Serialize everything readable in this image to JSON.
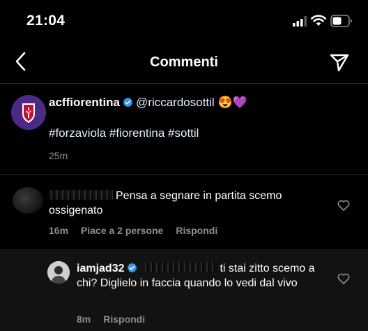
{
  "status_bar": {
    "time": "21:04"
  },
  "header": {
    "title": "Commenti"
  },
  "caption": {
    "username": "acffiorentina",
    "mention": "@riccardosottil",
    "emojis": "😍💜",
    "hashtags": "#forzaviola #fiorentina #sottil",
    "time": "25m"
  },
  "comments": [
    {
      "text": "Pensa a segnare in partita scemo ossigenato",
      "time": "16m",
      "likes": "Piace a 2 persone",
      "reply": "Rispondi"
    }
  ],
  "reply": {
    "username": "iamjad32",
    "text": "ti stai zitto scemo a chi? Diglielo in faccia quando lo vedi dal vivo",
    "time": "8m",
    "reply": "Rispondi"
  },
  "colors": {
    "background": "#000000",
    "highlight": "#121212",
    "secondary_text": "#8e8e8e",
    "verified": "#3897f0"
  }
}
